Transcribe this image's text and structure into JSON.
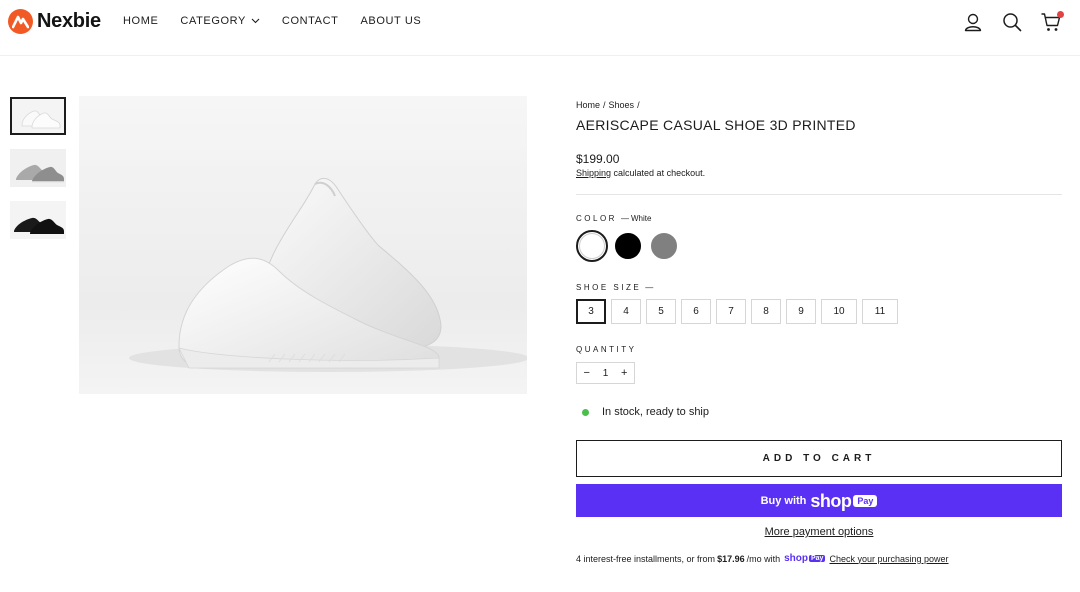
{
  "brand": {
    "name": "Nexbie",
    "accent": "#f15a24"
  },
  "nav": {
    "items": [
      {
        "label": "HOME"
      },
      {
        "label": "CATEGORY"
      },
      {
        "label": "CONTACT"
      },
      {
        "label": "ABOUT US"
      }
    ]
  },
  "header_icons": [
    "user-icon",
    "search-icon",
    "cart-icon"
  ],
  "gallery": {
    "thumbnails": [
      {
        "color": "white"
      },
      {
        "color": "gray"
      },
      {
        "color": "black"
      }
    ],
    "active_index": 0
  },
  "product": {
    "breadcrumb": [
      "Home",
      "/",
      "Shoes",
      "/"
    ],
    "title": "AERISCAPE CASUAL SHOE 3D PRINTED",
    "price": "$199.00",
    "shipping_link": "Shipping",
    "shipping_rest": " calculated at checkout."
  },
  "color_option": {
    "label": "COLOR",
    "dash": "—",
    "selected": "White",
    "swatches": [
      {
        "name": "White",
        "hex": "#ffffff"
      },
      {
        "name": "Black",
        "hex": "#000000"
      },
      {
        "name": "Gray",
        "hex": "#808080"
      }
    ]
  },
  "size_option": {
    "label": "SHOE SIZE",
    "dash": "—",
    "sizes": [
      "3",
      "4",
      "5",
      "6",
      "7",
      "8",
      "9",
      "10",
      "11"
    ],
    "selected": "3"
  },
  "quantity": {
    "label": "QUANTITY",
    "value": "1",
    "minus": "−",
    "plus": "+"
  },
  "stock": {
    "text": "In stock, ready to ship",
    "color": "#4bbf4b"
  },
  "actions": {
    "add_to_cart": "ADD TO CART",
    "buy_with": "Buy with",
    "shop": "shop",
    "pay": "Pay",
    "more_payment": "More payment options",
    "shop_pay_color": "#5a31f4"
  },
  "installments": {
    "prefix": "4 interest-free installments, or from",
    "amount": "$17.96",
    "suffix": "/mo with",
    "link": "Check your purchasing power"
  }
}
